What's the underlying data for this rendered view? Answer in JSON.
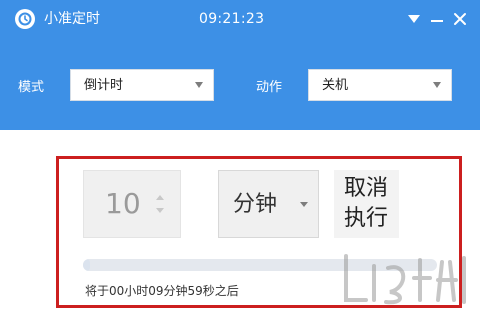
{
  "window": {
    "title": "小准定时",
    "clock": "09:21:23",
    "icons": {
      "app": "clock-icon",
      "dropdown": "triangle-down-icon",
      "minimize": "minimize-icon",
      "close": "close-icon"
    }
  },
  "settings": {
    "mode_label": "模式",
    "mode_value": "倒计时",
    "action_label": "动作",
    "action_value": "关机"
  },
  "timer": {
    "amount": "10",
    "unit": "分钟",
    "cancel_label": "取消执行",
    "progress_fraction": 0.02,
    "status": "将于00小时09分钟59秒之后"
  },
  "colors": {
    "primary": "#3d90e6",
    "highlight_border": "#cc1f1f"
  }
}
